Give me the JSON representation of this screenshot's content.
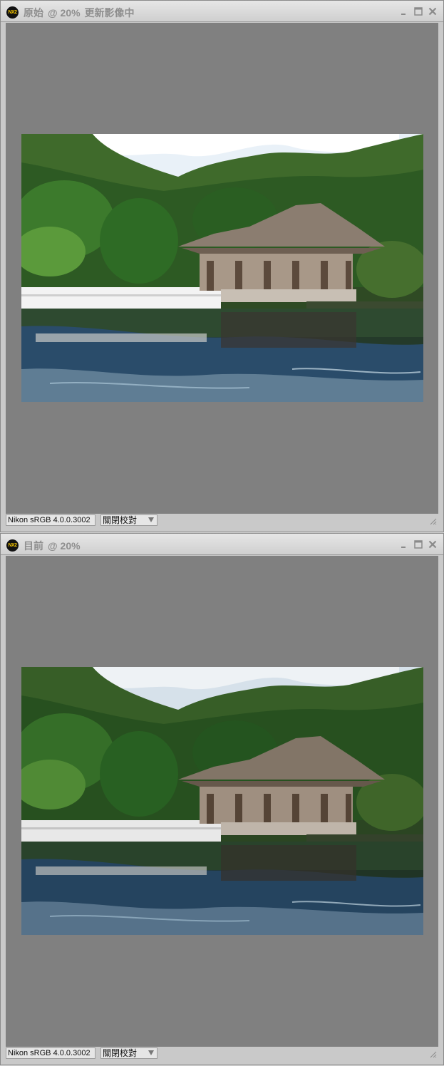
{
  "windows": [
    {
      "id": "original",
      "title": "原始",
      "zoom": "@ 20%",
      "status": "更新影像中",
      "app_icon_text": "NX2",
      "profile": "Nikon sRGB 4.0.0.3002",
      "proof": "關閉校對"
    },
    {
      "id": "current",
      "title": "目前",
      "zoom": "@ 20%",
      "status": "",
      "app_icon_text": "NX2",
      "profile": "Nikon sRGB 4.0.0.3002",
      "proof": "關閉校對"
    }
  ],
  "colors": {
    "canvas_bg": "#808080",
    "title_text": "#8e8e8e"
  }
}
